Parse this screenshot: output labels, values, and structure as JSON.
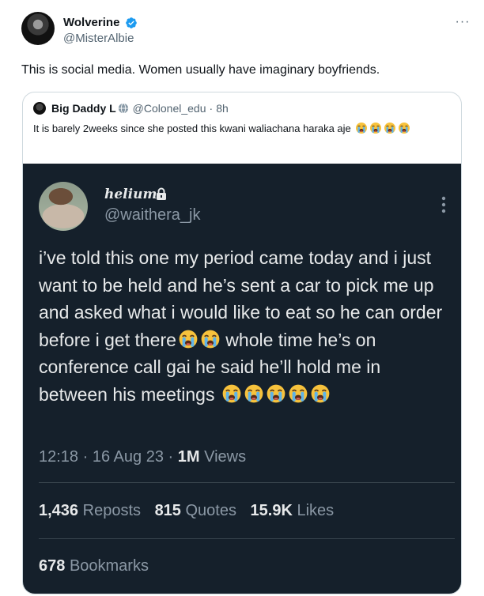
{
  "tweet": {
    "author_name": "Wolverine",
    "author_handle": "@MisterAlbie",
    "text": "This is social media. Women usually have imaginary boyfriends."
  },
  "quote": {
    "author_name": "Big Daddy L",
    "author_handle": "@Colonel_edu",
    "separator": "·",
    "time": "8h",
    "text": "It is barely 2weeks since she posted this kwani waliachana haraka aje",
    "emoji_count": 4
  },
  "media": {
    "name": "helium",
    "handle": "@waithera_jk",
    "text_part1": "i’ve told this one my period came today and i just want to be held and he’s sent a car to pick me up and asked what i would like to eat so he can order before i get there",
    "text_emoji_count1": 2,
    "text_part2": "whole time he’s on conference call gai  he said he’ll hold me in between his meetings",
    "text_emoji_count2": 5,
    "time": "12:18",
    "date": "16 Aug 23",
    "dot": "·",
    "views_count": "1M",
    "views_label": "Views",
    "reposts_count": "1,436",
    "reposts_label": "Reposts",
    "quotes_count": "815",
    "quotes_label": "Quotes",
    "likes_count": "15.9K",
    "likes_label": "Likes",
    "bookmarks_count": "678",
    "bookmarks_label": "Bookmarks"
  },
  "icons": {
    "verified": "verified-badge-icon",
    "more": "more-horizontal-icon",
    "globe": "affiliate-globe-icon",
    "lock": "lock-icon",
    "emoji": "loudly-crying-face-emoji"
  },
  "colors": {
    "verified_blue": "#1d9bf0",
    "media_background": "#15202b",
    "emoji_face": "#f7c23c",
    "tears": "#5eb3e8"
  }
}
